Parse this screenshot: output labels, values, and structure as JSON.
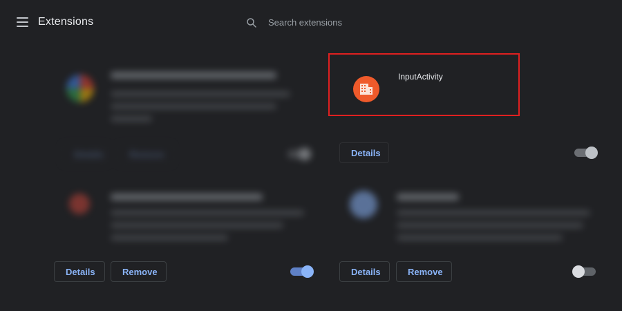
{
  "header": {
    "title": "Extensions",
    "search_placeholder": "Search extensions"
  },
  "extensions": [
    {
      "name": "",
      "details_label": "Details",
      "remove_label": "Remove"
    },
    {
      "name": "InputActivity",
      "details_label": "Details",
      "toggle_state": "on"
    },
    {
      "name": "",
      "details_label": "Details",
      "remove_label": "Remove",
      "toggle_state": "on"
    },
    {
      "name": "",
      "details_label": "Details",
      "remove_label": "Remove",
      "toggle_state": "off"
    }
  ],
  "colors": {
    "background": "#202124",
    "accent": "#8ab4f8",
    "highlight": "#e02020",
    "input_activity_icon": "#ef5a2b"
  },
  "icons": {
    "menu": "menu-icon",
    "search": "search-icon",
    "input_activity": "building-icon"
  }
}
